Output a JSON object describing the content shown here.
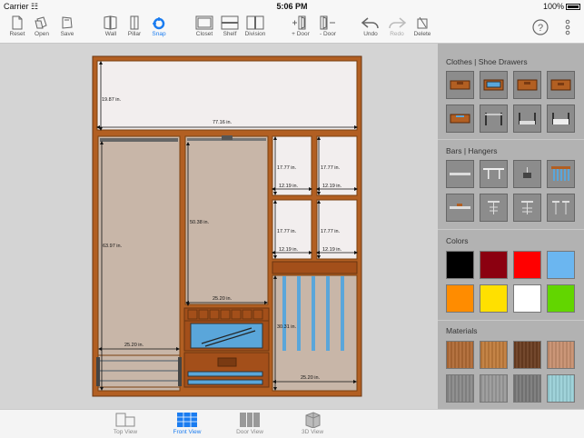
{
  "status_bar": {
    "carrier": "Carrier",
    "time": "5:06 PM",
    "battery": "100%"
  },
  "toolbar": {
    "reset": "Reset",
    "open": "Open",
    "save": "Save",
    "wall": "Wall",
    "pillar": "Pillar",
    "snap": "Snap",
    "closet": "Closet",
    "shelf": "Shelf",
    "division": "Division",
    "add_door": "+ Door",
    "remove_door": "- Door",
    "undo": "Undo",
    "redo": "Redo",
    "delete": "Delete",
    "help_icon": "question-mark-icon",
    "more_icon": "vertical-ellipsis-icon"
  },
  "closet": {
    "top_height": "19.87 in.",
    "total_width": "77.16 in.",
    "left_height": "63.97 in.",
    "left_width": "25.20 in.",
    "mid_height": "50.38 in.",
    "mid_width": "25.20 in.",
    "upper_cells": [
      {
        "height": "17.77 in.",
        "width": "12.19 in."
      },
      {
        "height": "17.77 in.",
        "width": "12.19 in."
      },
      {
        "height": "17.77 in.",
        "width": "12.19 in."
      },
      {
        "height": "17.77 in.",
        "width": "12.19 in."
      }
    ],
    "right_height": "30.31 in.",
    "right_width": "25.20 in."
  },
  "panel": {
    "clothes_title": "Clothes | Shoe Drawers",
    "bars_title": "Bars | Hangers",
    "colors_title": "Colors",
    "materials_title": "Materials",
    "colors": [
      "#000000",
      "#8b0010",
      "#ff0000",
      "#6bb6f0",
      "#ff8c00",
      "#ffe000",
      "#ffffff",
      "#62d600"
    ],
    "materials": [
      "#b06a35",
      "#c07c3c",
      "#6a3d20",
      "#c89070",
      "#8a8a8a",
      "#9a9a9a",
      "#7a7a7a",
      "#9ad0d8"
    ]
  },
  "tabs": {
    "top_view": "Top View",
    "front_view": "Front View",
    "door_view": "Door View",
    "view_3d": "3D View"
  }
}
